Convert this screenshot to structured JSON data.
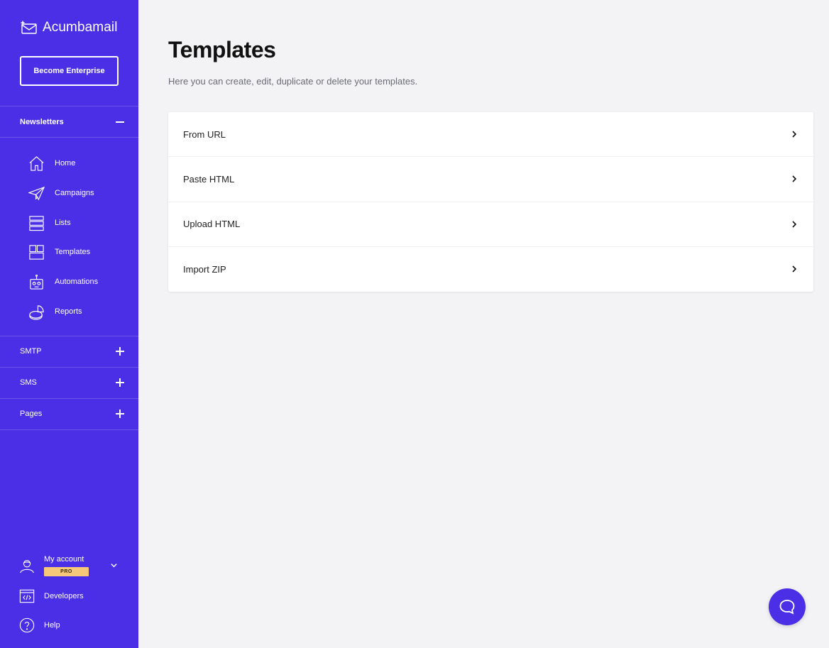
{
  "brand": {
    "name": "Acumbamail",
    "accent": "#4a2fe6"
  },
  "sidebar": {
    "cta_label": "Become Enterprise",
    "newsletters_label": "Newsletters",
    "items": [
      {
        "label": "Home",
        "icon": "home-icon"
      },
      {
        "label": "Campaigns",
        "icon": "paper-plane-icon"
      },
      {
        "label": "Lists",
        "icon": "list-icon"
      },
      {
        "label": "Templates",
        "icon": "templates-icon"
      },
      {
        "label": "Automations",
        "icon": "robot-icon"
      },
      {
        "label": "Reports",
        "icon": "pie-chart-icon"
      }
    ],
    "sections": [
      {
        "label": "SMTP"
      },
      {
        "label": "SMS"
      },
      {
        "label": "Pages"
      }
    ],
    "account": {
      "label": "My account",
      "badge": "PRO"
    },
    "developers_label": "Developers",
    "help_label": "Help"
  },
  "main": {
    "title": "Templates",
    "subtitle": "Here you can create, edit, duplicate or delete your templates.",
    "options": [
      {
        "label": "From URL"
      },
      {
        "label": "Paste HTML"
      },
      {
        "label": "Upload HTML"
      },
      {
        "label": "Import ZIP"
      }
    ]
  }
}
